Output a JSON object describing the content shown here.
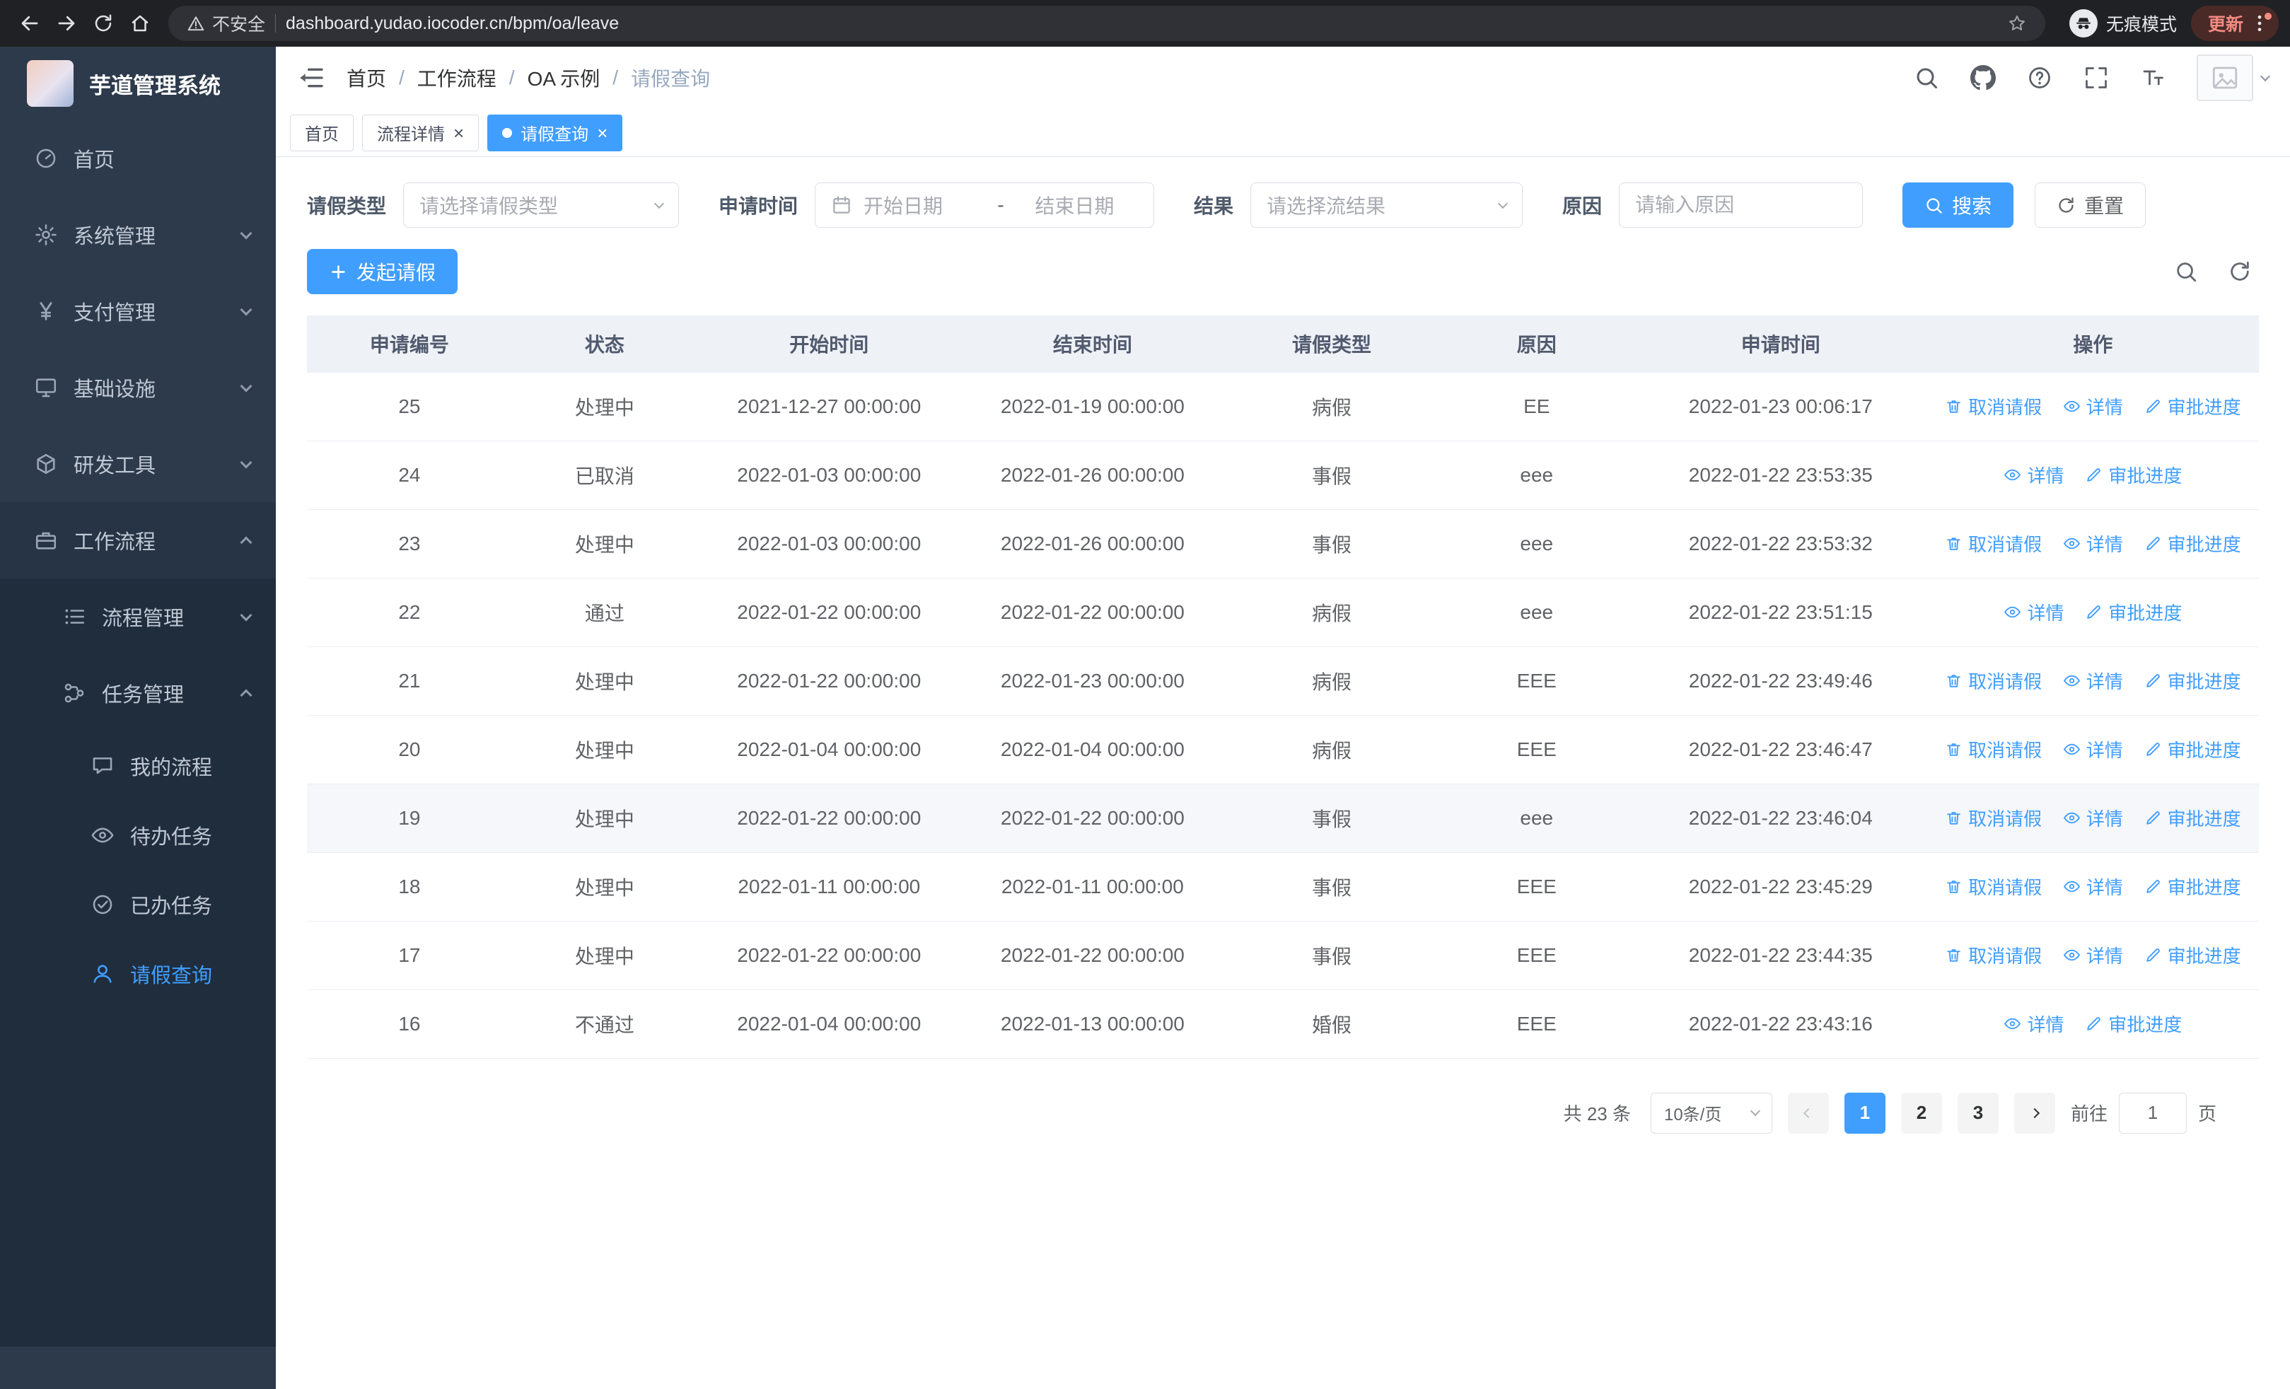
{
  "browser": {
    "security_label": "不安全",
    "url": "dashboard.yudao.iocoder.cn/bpm/oa/leave",
    "incognito_label": "无痕模式",
    "update_label": "更新"
  },
  "sidebar": {
    "logo_title": "芋道管理系统",
    "items": [
      {
        "label": "首页"
      },
      {
        "label": "系统管理"
      },
      {
        "label": "支付管理"
      },
      {
        "label": "基础设施"
      },
      {
        "label": "研发工具"
      },
      {
        "label": "工作流程"
      },
      {
        "label": "流程管理"
      },
      {
        "label": "任务管理"
      },
      {
        "label": "我的流程"
      },
      {
        "label": "待办任务"
      },
      {
        "label": "已办任务"
      },
      {
        "label": "请假查询"
      }
    ]
  },
  "header": {
    "breadcrumb": [
      "首页",
      "工作流程",
      "OA 示例",
      "请假查询"
    ],
    "separator": "/"
  },
  "tabs": [
    {
      "label": "首页"
    },
    {
      "label": "流程详情"
    },
    {
      "label": "请假查询"
    }
  ],
  "filters": {
    "leave_type_label": "请假类型",
    "leave_type_placeholder": "请选择请假类型",
    "apply_time_label": "申请时间",
    "start_placeholder": "开始日期",
    "range_separator": "-",
    "end_placeholder": "结束日期",
    "result_label": "结果",
    "result_placeholder": "请选择流结果",
    "reason_label": "原因",
    "reason_placeholder": "请输入原因",
    "search_label": "搜索",
    "reset_label": "重置"
  },
  "toolbar": {
    "create_label": "发起请假"
  },
  "table": {
    "columns": [
      "申请编号",
      "状态",
      "开始时间",
      "结束时间",
      "请假类型",
      "原因",
      "申请时间",
      "操作"
    ],
    "actions": {
      "cancel": "取消请假",
      "detail": "详情",
      "progress": "审批进度"
    },
    "rows": [
      {
        "id": "25",
        "status": "处理中",
        "start": "2021-12-27 00:00:00",
        "end": "2022-01-19 00:00:00",
        "type": "病假",
        "reason": "EE",
        "apply_time": "2022-01-23 00:06:17",
        "cancelable": true,
        "hovered": false
      },
      {
        "id": "24",
        "status": "已取消",
        "start": "2022-01-03 00:00:00",
        "end": "2022-01-26 00:00:00",
        "type": "事假",
        "reason": "eee",
        "apply_time": "2022-01-22 23:53:35",
        "cancelable": false,
        "hovered": false
      },
      {
        "id": "23",
        "status": "处理中",
        "start": "2022-01-03 00:00:00",
        "end": "2022-01-26 00:00:00",
        "type": "事假",
        "reason": "eee",
        "apply_time": "2022-01-22 23:53:32",
        "cancelable": true,
        "hovered": false
      },
      {
        "id": "22",
        "status": "通过",
        "start": "2022-01-22 00:00:00",
        "end": "2022-01-22 00:00:00",
        "type": "病假",
        "reason": "eee",
        "apply_time": "2022-01-22 23:51:15",
        "cancelable": false,
        "hovered": false
      },
      {
        "id": "21",
        "status": "处理中",
        "start": "2022-01-22 00:00:00",
        "end": "2022-01-23 00:00:00",
        "type": "病假",
        "reason": "EEE",
        "apply_time": "2022-01-22 23:49:46",
        "cancelable": true,
        "hovered": false
      },
      {
        "id": "20",
        "status": "处理中",
        "start": "2022-01-04 00:00:00",
        "end": "2022-01-04 00:00:00",
        "type": "病假",
        "reason": "EEE",
        "apply_time": "2022-01-22 23:46:47",
        "cancelable": true,
        "hovered": false
      },
      {
        "id": "19",
        "status": "处理中",
        "start": "2022-01-22 00:00:00",
        "end": "2022-01-22 00:00:00",
        "type": "事假",
        "reason": "eee",
        "apply_time": "2022-01-22 23:46:04",
        "cancelable": true,
        "hovered": true
      },
      {
        "id": "18",
        "status": "处理中",
        "start": "2022-01-11 00:00:00",
        "end": "2022-01-11 00:00:00",
        "type": "事假",
        "reason": "EEE",
        "apply_time": "2022-01-22 23:45:29",
        "cancelable": true,
        "hovered": false
      },
      {
        "id": "17",
        "status": "处理中",
        "start": "2022-01-22 00:00:00",
        "end": "2022-01-22 00:00:00",
        "type": "事假",
        "reason": "EEE",
        "apply_time": "2022-01-22 23:44:35",
        "cancelable": true,
        "hovered": false
      },
      {
        "id": "16",
        "status": "不通过",
        "start": "2022-01-04 00:00:00",
        "end": "2022-01-13 00:00:00",
        "type": "婚假",
        "reason": "EEE",
        "apply_time": "2022-01-22 23:43:16",
        "cancelable": false,
        "hovered": false
      }
    ]
  },
  "pagination": {
    "total": "共 23 条",
    "page_size": "10条/页",
    "pages": [
      "1",
      "2",
      "3"
    ],
    "active_page": "1",
    "goto_label": "前往",
    "goto_value": "1",
    "page_unit": "页"
  }
}
